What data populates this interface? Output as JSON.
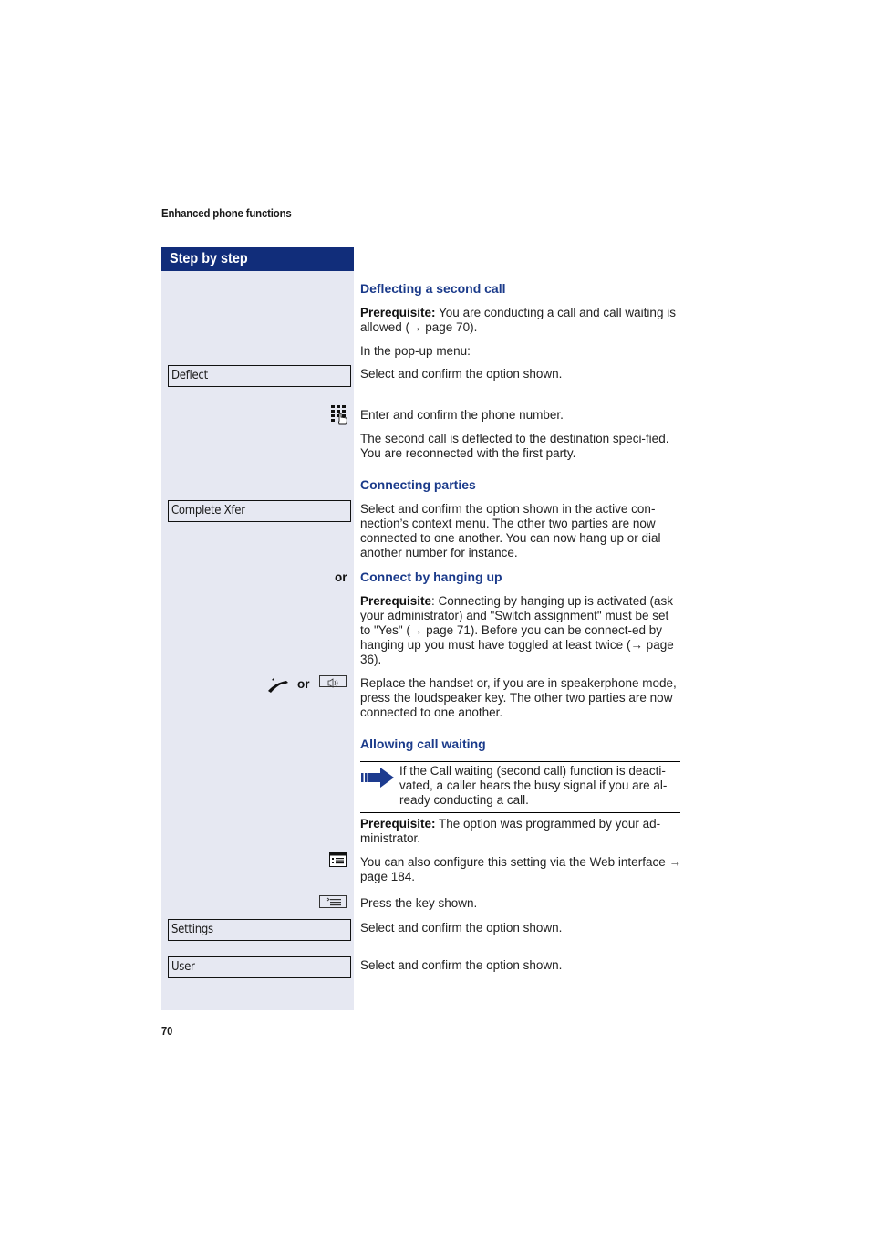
{
  "header": {
    "title": "Enhanced phone functions"
  },
  "sidebar": {
    "title": "Step by step"
  },
  "sections": {
    "deflecting": {
      "heading": "Deflecting a second call",
      "prereq_label": "Prerequisite:",
      "prereq_text": " You are conducting a call and call waiting is allowed (→ page 70).",
      "popup_text": "In the pop-up menu:",
      "menu_option": "Deflect",
      "select_text": "Select and confirm the option shown.",
      "enter_text": "Enter and confirm the phone number.",
      "result_text": "The second call is deflected to the destination speci-fied. You are reconnected with the first party."
    },
    "connecting": {
      "heading": "Connecting parties",
      "menu_option": "Complete Xfer",
      "select_text": "Select and confirm the option shown in the active con-nection’s context menu. The other two parties are now connected to one another. You can now hang up or dial another number for instance."
    },
    "hanging_up": {
      "or_label": "or",
      "heading": "Connect by hanging up",
      "prereq_label": "Prerequisite",
      "prereq_text": ": Connecting by hanging up is activated (ask your administrator) and \"Switch assignment\" must be set to \"Yes\" (→ page 71). Before you can be connect-ed by hanging up you must have toggled at least twice (→ page 36).",
      "icon_or_label": "or",
      "replace_text": "Replace the handset or, if you are in speakerphone mode, press the loudspeaker key. The other two parties are now connected to one another."
    },
    "call_waiting": {
      "heading": "Allowing call waiting",
      "note_text": "If the Call waiting (second call) function is deacti-vated, a caller hears the busy signal if you are al-ready conducting a call.",
      "prereq_label": "Prerequisite:",
      "prereq_text": " The option was programmed by your ad-ministrator.",
      "web_text": "You can also configure this setting via the Web interface → page 184.",
      "press_text": "Press the key shown.",
      "settings_option": "Settings",
      "settings_select_text": "Select and confirm the option shown.",
      "user_option": "User",
      "user_select_text": "Select and confirm the option shown."
    }
  },
  "footer": {
    "page_number": "70"
  },
  "colors": {
    "brand_blue": "#112d7a",
    "heading_blue": "#1a3a8a",
    "sidebar_bg": "#e6e8f2"
  }
}
